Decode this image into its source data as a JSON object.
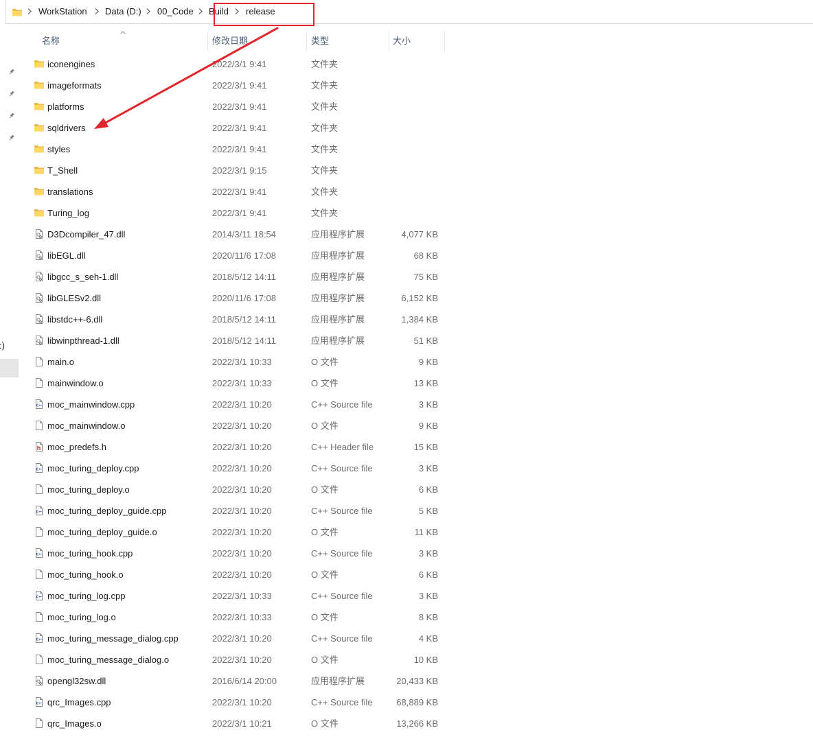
{
  "address_bar": {
    "root_icon": "folder-icon",
    "separator_icon": "chevron-right-icon",
    "crumbs": [
      {
        "label": "WorkStation"
      },
      {
        "label": "Data (D:)"
      },
      {
        "label": "00_Code"
      },
      {
        "label": "Build"
      },
      {
        "label": "release"
      }
    ]
  },
  "navigation_pane": {
    "pin_icon": "pin-icon",
    "pinned_item_count": 4,
    "truncated_label": ":)"
  },
  "columns": {
    "name": "名称",
    "modified": "修改日期",
    "type": "类型",
    "size": "大小",
    "sort_icon": "chevron-up-icon"
  },
  "files": [
    {
      "icon": "folder-icon",
      "name": "iconengines",
      "modified": "2022/3/1 9:41",
      "type": "文件夹"
    },
    {
      "icon": "folder-icon",
      "name": "imageformats",
      "modified": "2022/3/1 9:41",
      "type": "文件夹"
    },
    {
      "icon": "folder-icon",
      "name": "platforms",
      "modified": "2022/3/1 9:41",
      "type": "文件夹"
    },
    {
      "icon": "folder-icon",
      "name": "sqldrivers",
      "modified": "2022/3/1 9:41",
      "type": "文件夹"
    },
    {
      "icon": "folder-icon",
      "name": "styles",
      "modified": "2022/3/1 9:41",
      "type": "文件夹"
    },
    {
      "icon": "folder-icon",
      "name": "T_Shell",
      "modified": "2022/3/1 9:15",
      "type": "文件夹"
    },
    {
      "icon": "folder-icon",
      "name": "translations",
      "modified": "2022/3/1 9:41",
      "type": "文件夹"
    },
    {
      "icon": "folder-icon",
      "name": "Turing_log",
      "modified": "2022/3/1 9:41",
      "type": "文件夹"
    },
    {
      "icon": "dll-file-icon",
      "name": "D3Dcompiler_47.dll",
      "modified": "2014/3/11 18:54",
      "type": "应用程序扩展",
      "size": "4,077 KB"
    },
    {
      "icon": "dll-file-icon",
      "name": "libEGL.dll",
      "modified": "2020/11/6 17:08",
      "type": "应用程序扩展",
      "size": "68 KB"
    },
    {
      "icon": "dll-file-icon",
      "name": "libgcc_s_seh-1.dll",
      "modified": "2018/5/12 14:11",
      "type": "应用程序扩展",
      "size": "75 KB"
    },
    {
      "icon": "dll-file-icon",
      "name": "libGLESv2.dll",
      "modified": "2020/11/6 17:08",
      "type": "应用程序扩展",
      "size": "6,152 KB"
    },
    {
      "icon": "dll-file-icon",
      "name": "libstdc++-6.dll",
      "modified": "2018/5/12 14:11",
      "type": "应用程序扩展",
      "size": "1,384 KB"
    },
    {
      "icon": "dll-file-icon",
      "name": "libwinpthread-1.dll",
      "modified": "2018/5/12 14:11",
      "type": "应用程序扩展",
      "size": "51 KB"
    },
    {
      "icon": "blank-file-icon",
      "name": "main.o",
      "modified": "2022/3/1 10:33",
      "type": "O 文件",
      "size": "9 KB"
    },
    {
      "icon": "blank-file-icon",
      "name": "mainwindow.o",
      "modified": "2022/3/1 10:33",
      "type": "O 文件",
      "size": "13 KB"
    },
    {
      "icon": "cpp-file-icon",
      "name": "moc_mainwindow.cpp",
      "modified": "2022/3/1 10:20",
      "type": "C++ Source file",
      "size": "3 KB"
    },
    {
      "icon": "blank-file-icon",
      "name": "moc_mainwindow.o",
      "modified": "2022/3/1 10:20",
      "type": "O 文件",
      "size": "9 KB"
    },
    {
      "icon": "header-file-icon",
      "name": "moc_predefs.h",
      "modified": "2022/3/1 10:20",
      "type": "C++ Header file",
      "size": "15 KB"
    },
    {
      "icon": "cpp-file-icon",
      "name": "moc_turing_deploy.cpp",
      "modified": "2022/3/1 10:20",
      "type": "C++ Source file",
      "size": "3 KB"
    },
    {
      "icon": "blank-file-icon",
      "name": "moc_turing_deploy.o",
      "modified": "2022/3/1 10:20",
      "type": "O 文件",
      "size": "6 KB"
    },
    {
      "icon": "cpp-file-icon",
      "name": "moc_turing_deploy_guide.cpp",
      "modified": "2022/3/1 10:20",
      "type": "C++ Source file",
      "size": "5 KB"
    },
    {
      "icon": "blank-file-icon",
      "name": "moc_turing_deploy_guide.o",
      "modified": "2022/3/1 10:20",
      "type": "O 文件",
      "size": "11 KB"
    },
    {
      "icon": "cpp-file-icon",
      "name": "moc_turing_hook.cpp",
      "modified": "2022/3/1 10:20",
      "type": "C++ Source file",
      "size": "3 KB"
    },
    {
      "icon": "blank-file-icon",
      "name": "moc_turing_hook.o",
      "modified": "2022/3/1 10:20",
      "type": "O 文件",
      "size": "6 KB"
    },
    {
      "icon": "cpp-file-icon",
      "name": "moc_turing_log.cpp",
      "modified": "2022/3/1 10:33",
      "type": "C++ Source file",
      "size": "3 KB"
    },
    {
      "icon": "blank-file-icon",
      "name": "moc_turing_log.o",
      "modified": "2022/3/1 10:33",
      "type": "O 文件",
      "size": "8 KB"
    },
    {
      "icon": "cpp-file-icon",
      "name": "moc_turing_message_dialog.cpp",
      "modified": "2022/3/1 10:20",
      "type": "C++ Source file",
      "size": "4 KB"
    },
    {
      "icon": "blank-file-icon",
      "name": "moc_turing_message_dialog.o",
      "modified": "2022/3/1 10:20",
      "type": "O 文件",
      "size": "10 KB"
    },
    {
      "icon": "dll-file-icon",
      "name": "opengl32sw.dll",
      "modified": "2016/6/14 20:00",
      "type": "应用程序扩展",
      "size": "20,433 KB"
    },
    {
      "icon": "cpp-file-icon",
      "name": "qrc_Images.cpp",
      "modified": "2022/3/1 10:20",
      "type": "C++ Source file",
      "size": "68,889 KB"
    },
    {
      "icon": "blank-file-icon",
      "name": "qrc_Images.o",
      "modified": "2022/3/1 10:21",
      "type": "O 文件",
      "size": "13,266 KB"
    }
  ],
  "colors": {
    "annotation": "#e3262b",
    "header_text": "#4c607a",
    "secondary_text": "#6d6d6d"
  }
}
